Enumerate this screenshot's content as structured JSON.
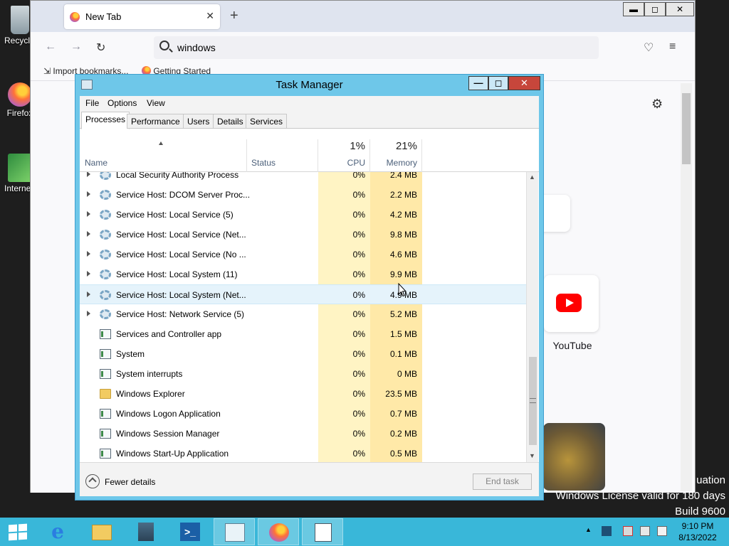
{
  "desktop": {
    "icons": [
      {
        "label": "Recycle Bin"
      },
      {
        "label": "Firefox"
      },
      {
        "label": "Internet Download Manager"
      }
    ]
  },
  "firefox": {
    "tab_title": "New Tab",
    "url_text": "windows",
    "bookmarks": [
      "Import bookmarks...",
      "Getting Started"
    ],
    "tile_label": "YouTube"
  },
  "taskmanager": {
    "title": "Task Manager",
    "menu": [
      "File",
      "Options",
      "View"
    ],
    "tabs": [
      "Processes",
      "Performance",
      "Users",
      "Details",
      "Services"
    ],
    "columns": {
      "name": "Name",
      "status": "Status",
      "cpu": "CPU",
      "cpu_pct": "1%",
      "memory": "Memory",
      "memory_pct": "21%"
    },
    "rows": [
      {
        "name": "Local Security Authority Process",
        "cpu": "0%",
        "mem": "2.4 MB",
        "icon": "gear-icon",
        "expandable": true
      },
      {
        "name": "Service Host: DCOM Server Proc...",
        "cpu": "0%",
        "mem": "2.2 MB",
        "icon": "gear-icon",
        "expandable": true
      },
      {
        "name": "Service Host: Local Service (5)",
        "cpu": "0%",
        "mem": "4.2 MB",
        "icon": "gear-icon",
        "expandable": true
      },
      {
        "name": "Service Host: Local Service (Net...",
        "cpu": "0%",
        "mem": "9.8 MB",
        "icon": "gear-icon",
        "expandable": true
      },
      {
        "name": "Service Host: Local Service (No ...",
        "cpu": "0%",
        "mem": "4.6 MB",
        "icon": "gear-icon",
        "expandable": true
      },
      {
        "name": "Service Host: Local System (11)",
        "cpu": "0%",
        "mem": "9.9 MB",
        "icon": "gear-icon",
        "expandable": true
      },
      {
        "name": "Service Host: Local System (Net...",
        "cpu": "0%",
        "mem": "4.9 MB",
        "icon": "gear-icon",
        "expandable": true
      },
      {
        "name": "Service Host: Network Service (5)",
        "cpu": "0%",
        "mem": "5.2 MB",
        "icon": "gear-icon",
        "expandable": true
      },
      {
        "name": "Services and Controller app",
        "cpu": "0%",
        "mem": "1.5 MB",
        "icon": "app-icon",
        "expandable": false
      },
      {
        "name": "System",
        "cpu": "0%",
        "mem": "0.1 MB",
        "icon": "app-icon",
        "expandable": false
      },
      {
        "name": "System interrupts",
        "cpu": "0%",
        "mem": "0 MB",
        "icon": "app-icon",
        "expandable": false
      },
      {
        "name": "Windows Explorer",
        "cpu": "0%",
        "mem": "23.5 MB",
        "icon": "folder-icon",
        "expandable": false
      },
      {
        "name": "Windows Logon Application",
        "cpu": "0%",
        "mem": "0.7 MB",
        "icon": "app-icon",
        "expandable": false
      },
      {
        "name": "Windows Session Manager",
        "cpu": "0%",
        "mem": "0.2 MB",
        "icon": "app-icon",
        "expandable": false
      },
      {
        "name": "Windows Start-Up Application",
        "cpu": "0%",
        "mem": "0.5 MB",
        "icon": "app-icon",
        "expandable": false
      }
    ],
    "fewer_details": "Fewer details",
    "end_task": "End task"
  },
  "watermark": {
    "line1": "uation",
    "line2": "Windows License valid for 180 days",
    "line3": "Build 9600"
  },
  "taskbar": {
    "time": "9:10 PM",
    "date": "8/13/2022"
  },
  "colors": {
    "taskbar": "#39b7d9",
    "taskmanager_frame": "#6ec7e9",
    "close_button": "#c7463b",
    "cpu_heat": "#fff4c4",
    "memory_heat": "#ffe9a8"
  }
}
